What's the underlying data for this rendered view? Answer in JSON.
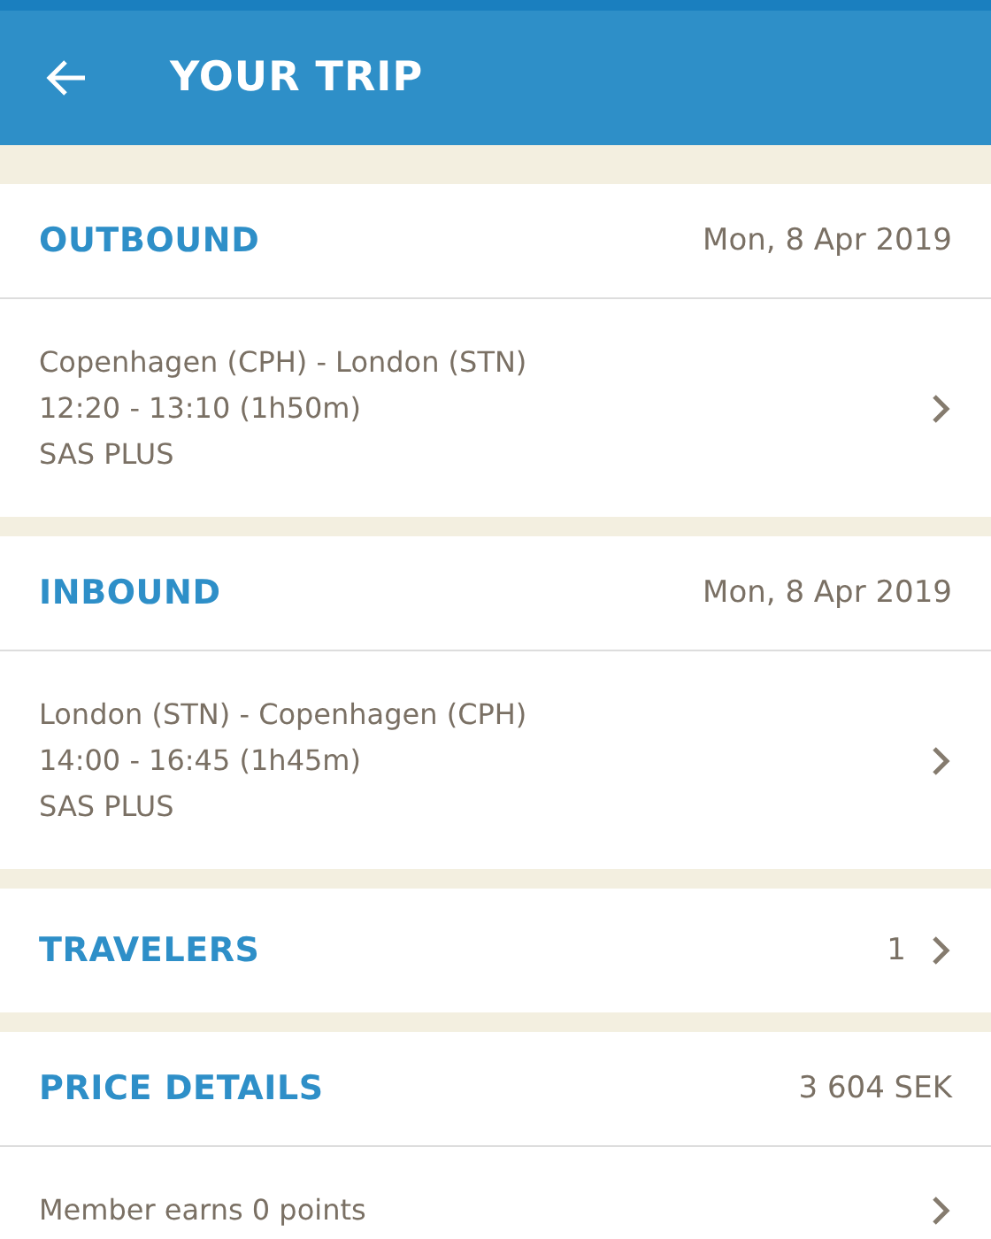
{
  "header": {
    "title": "YOUR TRIP"
  },
  "sections": [
    {
      "kind": "flight",
      "title": "OUTBOUND",
      "value": "Mon, 8 Apr 2019",
      "lines": [
        "Copenhagen (CPH) - London (STN)",
        "12:20 - 13:10 (1h50m)",
        "SAS PLUS"
      ]
    },
    {
      "kind": "flight",
      "title": "INBOUND",
      "value": "Mon, 8 Apr 2019",
      "lines": [
        "London (STN) - Copenhagen (CPH)",
        "14:00 - 16:45 (1h45m)",
        "SAS PLUS"
      ]
    },
    {
      "kind": "link",
      "title": "TRAVELERS",
      "value": "1"
    },
    {
      "kind": "price",
      "title": "PRICE DETAILS",
      "value": "3 604 SEK",
      "lines": [
        "Member earns 0 points"
      ]
    }
  ]
}
